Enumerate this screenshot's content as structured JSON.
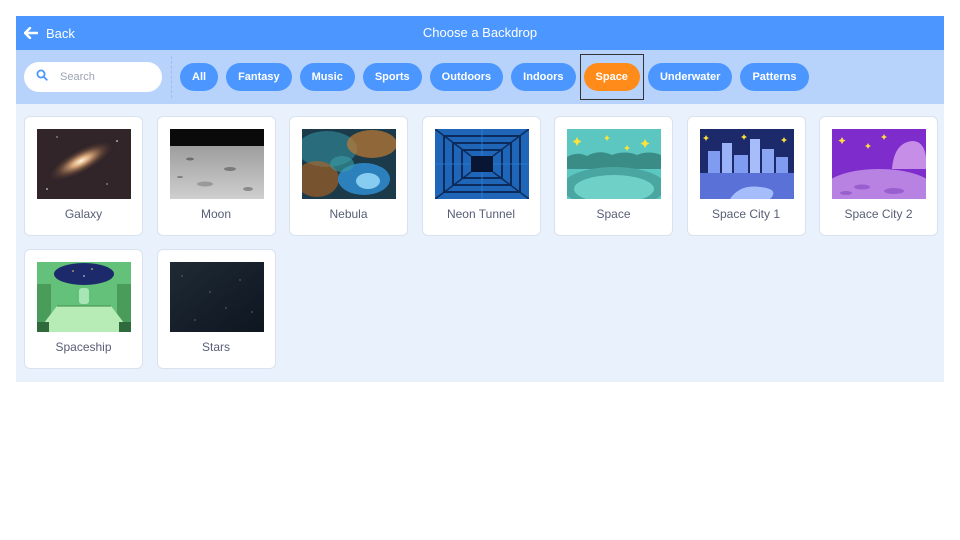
{
  "header": {
    "back_label": "Back",
    "title": "Choose a Backdrop"
  },
  "search": {
    "placeholder": "Search"
  },
  "tags": [
    {
      "label": "All"
    },
    {
      "label": "Fantasy"
    },
    {
      "label": "Music"
    },
    {
      "label": "Sports"
    },
    {
      "label": "Outdoors"
    },
    {
      "label": "Indoors"
    },
    {
      "label": "Space",
      "active": true
    },
    {
      "label": "Underwater"
    },
    {
      "label": "Patterns"
    }
  ],
  "backdrops": [
    {
      "name": "Galaxy",
      "thumbnail": "galaxy-thumbnail"
    },
    {
      "name": "Moon",
      "thumbnail": "moon-thumbnail"
    },
    {
      "name": "Nebula",
      "thumbnail": "nebula-thumbnail"
    },
    {
      "name": "Neon Tunnel",
      "thumbnail": "neon-tunnel-thumbnail"
    },
    {
      "name": "Space",
      "thumbnail": "space-thumbnail"
    },
    {
      "name": "Space City 1",
      "thumbnail": "space-city-1-thumbnail"
    },
    {
      "name": "Space City 2",
      "thumbnail": "space-city-2-thumbnail"
    },
    {
      "name": "Spaceship",
      "thumbnail": "spaceship-thumbnail"
    },
    {
      "name": "Stars",
      "thumbnail": "stars-thumbnail"
    }
  ],
  "colors": {
    "header": "#4c97ff",
    "filter_bar": "#b8d3fb",
    "tag": "#4c97ff",
    "tag_active": "#ff8c1a",
    "background": "#e9f1fc"
  }
}
